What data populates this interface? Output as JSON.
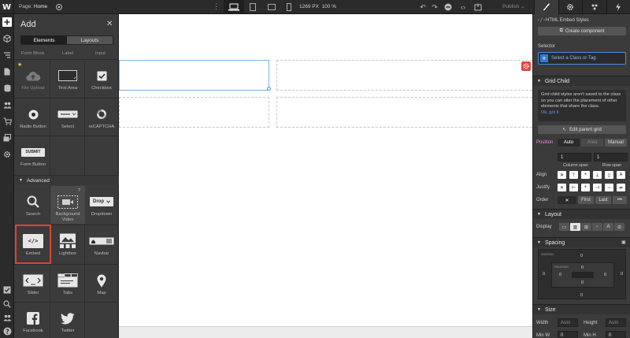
{
  "topbar": {
    "page_prefix": "Page:",
    "page_name": "Home",
    "canvas_width": "1269 PX",
    "zoom": "100 %",
    "publish_label": "Publish",
    "publish_arrow": "⌄"
  },
  "add_panel": {
    "title": "Add",
    "tabs": [
      "Elements",
      "Layouts"
    ],
    "partial_row": [
      "Form Block",
      "Label",
      "Input"
    ],
    "forms": [
      {
        "label": "File Upload",
        "icon": "cloud-upload-icon",
        "dim": true
      },
      {
        "label": "Text Area",
        "icon": "textarea-icon"
      },
      {
        "label": "Checkbox",
        "icon": "checkbox-icon"
      },
      {
        "label": "Radio Button",
        "icon": "radio-icon"
      },
      {
        "label": "Select",
        "icon": "select-icon"
      },
      {
        "label": "reCAPTCHA",
        "icon": "recaptcha-icon"
      },
      {
        "label": "Form Button",
        "icon": "submit-icon"
      }
    ],
    "submit_text": "SUBMIT",
    "advanced_title": "Advanced",
    "advanced": [
      {
        "label": "Search",
        "icon": "search-icon"
      },
      {
        "label": "Background Video",
        "icon": "video-icon"
      },
      {
        "label": "Dropdown",
        "icon": "dropdown-icon"
      },
      {
        "label": "Embed",
        "icon": "code-icon",
        "selected": true
      },
      {
        "label": "Lightbox",
        "icon": "lightbox-icon"
      },
      {
        "label": "Navbar",
        "icon": "navbar-icon"
      },
      {
        "label": "Slider",
        "icon": "slider-icon"
      },
      {
        "label": "Tabs",
        "icon": "tabs-icon"
      },
      {
        "label": "Map",
        "icon": "map-pin-icon"
      },
      {
        "label": "Facebook",
        "icon": "facebook-icon"
      },
      {
        "label": "Twitter",
        "icon": "twitter-icon"
      }
    ],
    "drop_text": "Drop",
    "embed_glyph": "</>",
    "video_badge": "?"
  },
  "right_panel": {
    "element_name": "HTML Embed Styles",
    "create_component": "Create component",
    "selector_label": "Selector",
    "selector_placeholder": "Select a Class or Tag",
    "grid_child_title": "Grid Child",
    "info_text": "Grid child styles aren't saved to the class so you can alter the placement of other elements that share the class.",
    "info_link": "Ok, got it",
    "edit_parent_grid": "Edit parent grid",
    "position_label": "Position",
    "position_options": [
      "Auto",
      "Area",
      "Manual"
    ],
    "column_span_value": "1",
    "row_span_value": "1",
    "column_span_label": "Column span",
    "row_span_label": "Row span",
    "align_label": "Align",
    "justify_label": "Justify",
    "order_label": "Order",
    "order_first": "First",
    "order_last": "Last",
    "order_more": "•••",
    "layout_title": "Layout",
    "display_label": "Display",
    "spacing_title": "Spacing",
    "margin_label": "MARGIN",
    "padding_label": "PADDING",
    "zero": "0",
    "size_title": "Size",
    "width_label": "Width",
    "height_label": "Height",
    "auto": "Auto",
    "min_w_label": "Min W",
    "min_h_label": "Min H"
  },
  "colors": {
    "accent_blue": "#4a90e2",
    "selection_red": "#d9462f",
    "position_pink": "#e78ee6",
    "panel_bg": "#3b3b3b",
    "bar_bg": "#2b2b2b"
  }
}
